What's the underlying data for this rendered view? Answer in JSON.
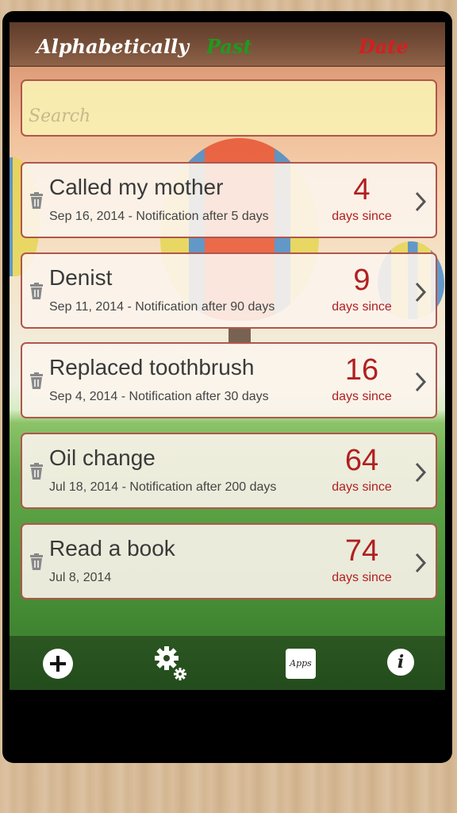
{
  "sort_tabs": {
    "alphabetically": "Alphabetically",
    "past": "Past",
    "date": "Date"
  },
  "search": {
    "placeholder": "Search",
    "value": ""
  },
  "items": [
    {
      "title": "Called my mother",
      "subtitle": "Sep 16, 2014 - Notification after 5 days",
      "count": "4",
      "unit": "days since"
    },
    {
      "title": "Denist",
      "subtitle": "Sep 11, 2014 - Notification after 90 days",
      "count": "9",
      "unit": "days since"
    },
    {
      "title": "Replaced toothbrush",
      "subtitle": "Sep 4, 2014 - Notification after 30 days",
      "count": "16",
      "unit": "days since"
    },
    {
      "title": "Oil change",
      "subtitle": "Jul 18, 2014 - Notification after 200 days",
      "count": "64",
      "unit": "days since"
    },
    {
      "title": "Read a book",
      "subtitle": "Jul 8, 2014",
      "count": "74",
      "unit": "days since"
    }
  ],
  "toolbar": {
    "add_icon": "plus-circle-icon",
    "settings_icon": "gear-icon",
    "apps_label": "Apps",
    "info_label": "i"
  },
  "colors": {
    "count_red": "#b02020",
    "past_green": "#1f9a1f",
    "date_red": "#d41f1f",
    "card_border": "#b0564c"
  }
}
